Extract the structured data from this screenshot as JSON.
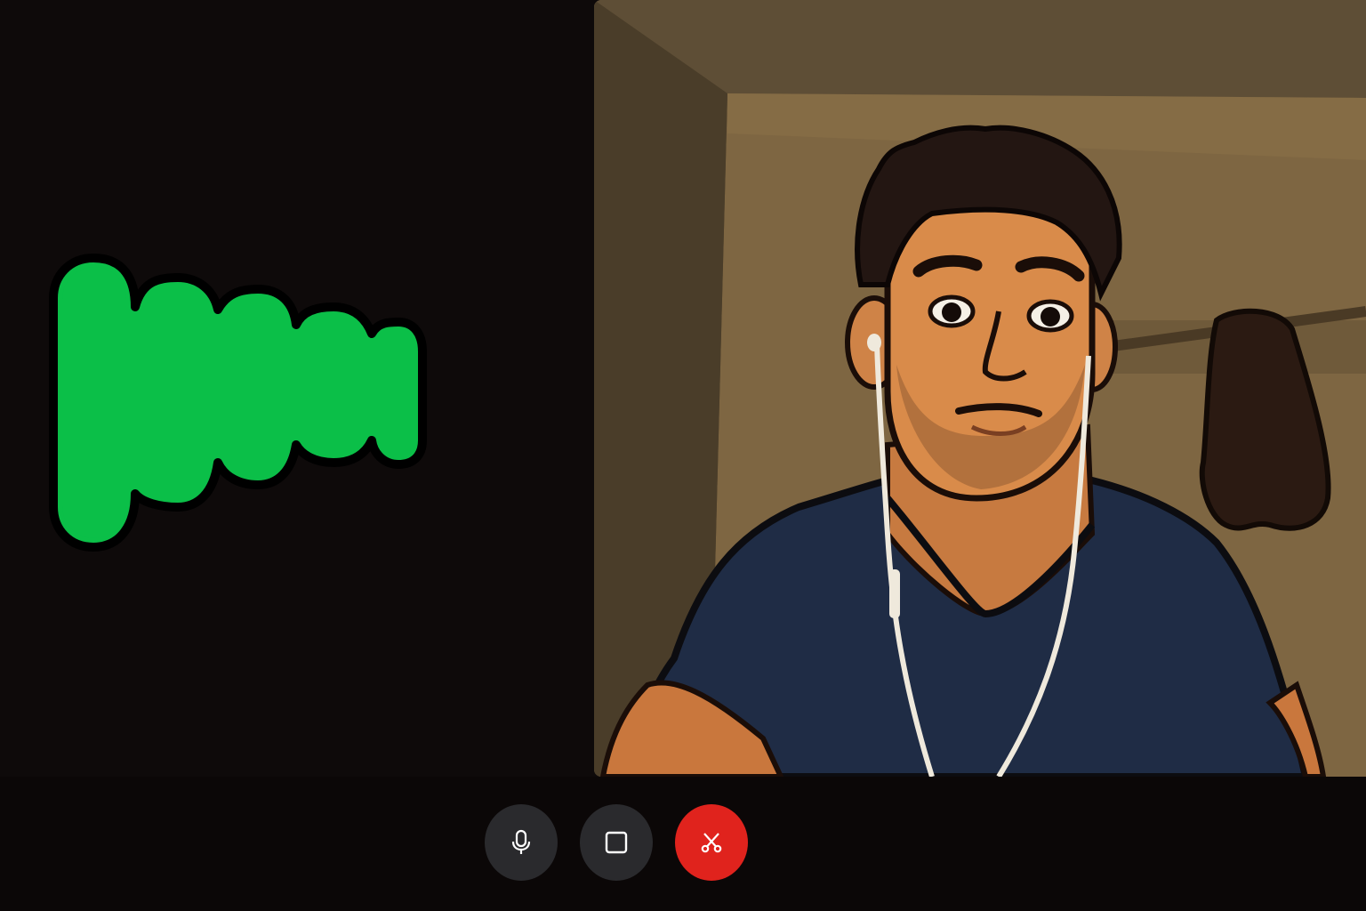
{
  "call": {
    "left_tile": {
      "indicator_icon": "audio-waveform-icon",
      "indicator_color": "#0bbf48"
    },
    "video_tile": {
      "content": "participant-video"
    }
  },
  "controls": [
    {
      "icon": "microphone-icon",
      "color": "#2a2a2d"
    },
    {
      "icon": "stop-square-icon",
      "color": "#2a2a2d"
    },
    {
      "icon": "scissors-icon",
      "color": "#e0231d"
    }
  ]
}
